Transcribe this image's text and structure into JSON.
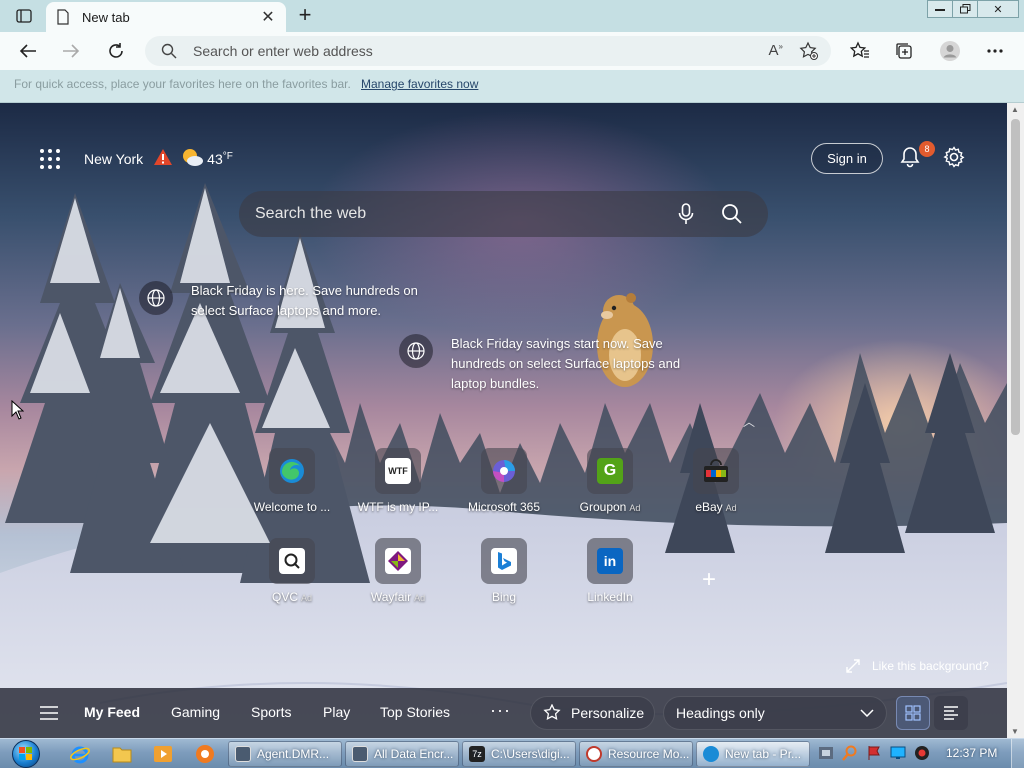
{
  "browser": {
    "tab_title": "New tab",
    "address_placeholder": "Search or enter web address",
    "favbar_hint": "For quick access, place your favorites here on the favorites bar.",
    "favbar_link": "Manage favorites now"
  },
  "newtab": {
    "city": "New York",
    "temperature": "43",
    "temp_unit": "°F",
    "sign_in": "Sign in",
    "notification_count": "8",
    "search_placeholder": "Search the web",
    "promos": [
      {
        "text": "Black Friday is here. Save hundreds on select Surface laptops and more."
      },
      {
        "text": "Black Friday savings start now. Save hundreds on select Surface laptops and laptop bundles."
      }
    ],
    "tiles": [
      {
        "label": "Welcome to ...",
        "ad": ""
      },
      {
        "label": "WTF is my IP...",
        "ad": ""
      },
      {
        "label": "Microsoft 365",
        "ad": ""
      },
      {
        "label": "Groupon",
        "ad": "Ad"
      },
      {
        "label": "eBay",
        "ad": "Ad"
      },
      {
        "label": "QVC",
        "ad": "Ad"
      },
      {
        "label": "Wayfair",
        "ad": "Ad"
      },
      {
        "label": "Bing",
        "ad": ""
      },
      {
        "label": "LinkedIn",
        "ad": ""
      }
    ],
    "wtf_icon_text": "WTF",
    "groupon_icon_text": "G",
    "linkedin_icon_text": "in",
    "like_background": "Like this background?",
    "feed": {
      "tabs": [
        "My Feed",
        "Gaming",
        "Sports",
        "Play",
        "Top Stories"
      ],
      "more": "···",
      "personalize": "Personalize",
      "headings": "Headings only"
    }
  },
  "taskbar": {
    "tasks": [
      {
        "label": "Agent.DMR..."
      },
      {
        "label": "All Data Encr..."
      },
      {
        "label": "C:\\Users\\digi..."
      },
      {
        "label": "Resource Mo..."
      },
      {
        "label": "New tab - Pr..."
      }
    ],
    "clock": "12:37 PM"
  },
  "colors": {
    "accent": "#c5dfe3",
    "badge": "#e25b2e",
    "alert": "#e2462a"
  }
}
